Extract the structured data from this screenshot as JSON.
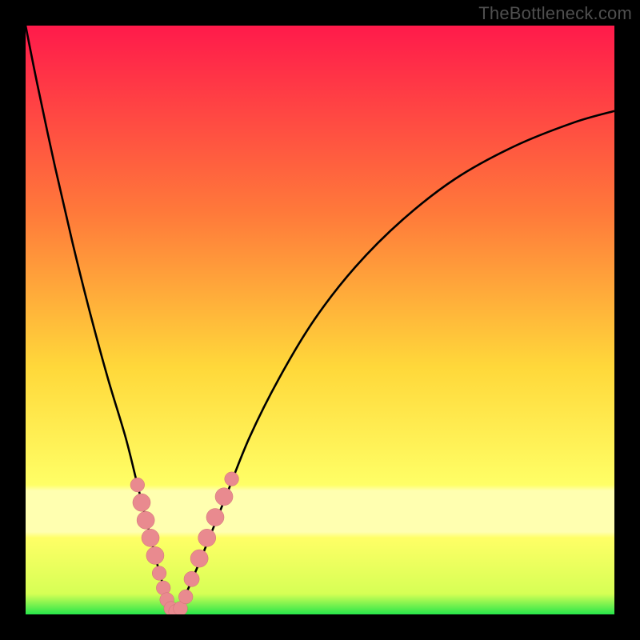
{
  "watermark": "TheBottleneck.com",
  "colors": {
    "frame": "#000000",
    "top": "#ff1a4b",
    "mid_upper": "#ff7a3a",
    "mid": "#ffd83a",
    "mid_lower": "#ffff66",
    "pale_band": "#ffffb0",
    "green": "#27e64a",
    "curve": "#000000",
    "marker_fill": "#e98a8f",
    "marker_stroke": "#cf6f75"
  },
  "chart_data": {
    "type": "line",
    "title": "",
    "xlabel": "",
    "ylabel": "",
    "xlim": [
      0,
      100
    ],
    "ylim": [
      0,
      100
    ],
    "grid": false,
    "legend": false,
    "series": [
      {
        "name": "bottleneck-curve",
        "x": [
          0,
          2,
          5,
          8,
          11,
          14,
          17,
          19,
          21,
          22.5,
          24,
          25.5,
          27,
          30,
          34,
          38,
          43,
          49,
          56,
          64,
          73,
          83,
          93,
          100
        ],
        "y": [
          100,
          90,
          76,
          63,
          51,
          40,
          30,
          22,
          14,
          8,
          3,
          0.5,
          3,
          10,
          20,
          30,
          40,
          50,
          59,
          67,
          74,
          79.5,
          83.5,
          85.5
        ]
      }
    ],
    "markers": {
      "name": "highlighted-points",
      "points": [
        {
          "x": 19.0,
          "y": 22.0,
          "r": 1.2
        },
        {
          "x": 19.7,
          "y": 19.0,
          "r": 1.5
        },
        {
          "x": 20.4,
          "y": 16.0,
          "r": 1.5
        },
        {
          "x": 21.2,
          "y": 13.0,
          "r": 1.5
        },
        {
          "x": 22.0,
          "y": 10.0,
          "r": 1.5
        },
        {
          "x": 22.7,
          "y": 7.0,
          "r": 1.2
        },
        {
          "x": 23.4,
          "y": 4.5,
          "r": 1.2
        },
        {
          "x": 24.0,
          "y": 2.5,
          "r": 1.2
        },
        {
          "x": 24.7,
          "y": 1.0,
          "r": 1.2
        },
        {
          "x": 25.5,
          "y": 0.5,
          "r": 1.2
        },
        {
          "x": 26.3,
          "y": 1.0,
          "r": 1.2
        },
        {
          "x": 27.2,
          "y": 3.0,
          "r": 1.2
        },
        {
          "x": 28.2,
          "y": 6.0,
          "r": 1.3
        },
        {
          "x": 29.5,
          "y": 9.5,
          "r": 1.5
        },
        {
          "x": 30.8,
          "y": 13.0,
          "r": 1.5
        },
        {
          "x": 32.2,
          "y": 16.5,
          "r": 1.5
        },
        {
          "x": 33.7,
          "y": 20.0,
          "r": 1.5
        },
        {
          "x": 35.0,
          "y": 23.0,
          "r": 1.2
        }
      ]
    }
  }
}
